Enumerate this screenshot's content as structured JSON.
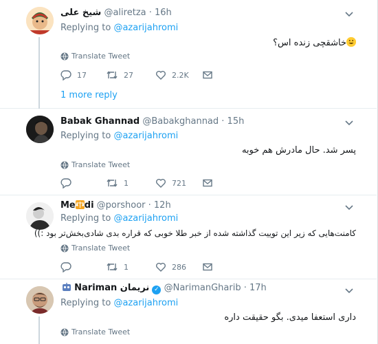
{
  "tweets": [
    {
      "name": "شیخ علی",
      "handle": "@aliretza",
      "time": "· 16h",
      "replying_prefix": "Replying to",
      "replying_to": "@azarijahromi",
      "text": "خاشقچی زنده اس؟",
      "translate": "Translate Tweet",
      "replies": "17",
      "retweets": "27",
      "likes": "2.2K",
      "more": "1 more reply"
    },
    {
      "name": "Babak Ghannad",
      "handle": "@Babakghannad",
      "time": "· 15h",
      "replying_prefix": "Replying to",
      "replying_to": "@azarijahromi",
      "text": "پسر شد. حال مادرش هم خوبه",
      "translate": "Translate Tweet",
      "replies": "",
      "retweets": "1",
      "likes": "721"
    },
    {
      "name_part1": "Me",
      "name_part2": "di",
      "handle": "@porshoor",
      "time": "· 12h",
      "replying_prefix": "Replying to",
      "replying_to": "@azarijahromi",
      "text": "کامنت‌هایی که زیر این توییت گذاشته شده از خبر طلا خوبی که قراره بدی شادی‌بخش‌تر بود :))",
      "translate": "Translate Tweet",
      "replies": "",
      "retweets": "1",
      "likes": "286"
    },
    {
      "name_latin": "Nariman",
      "name_fa": "نریمان",
      "handle": "@NarimanGharib",
      "time": "· 17h",
      "replying_prefix": "Replying to",
      "replying_to": "@azarijahromi",
      "text": "داری استعفا میدی. بگو حقیقت داره",
      "translate": "Translate Tweet"
    }
  ],
  "icons": {
    "reply": "reply-icon",
    "retweet": "retweet-icon",
    "like": "heart-icon",
    "dm": "envelope-icon",
    "globe": "globe-icon",
    "chevron": "chevron-down-icon"
  },
  "colors": {
    "link": "#1da1f2",
    "muted": "#657786",
    "text": "#14171a"
  }
}
